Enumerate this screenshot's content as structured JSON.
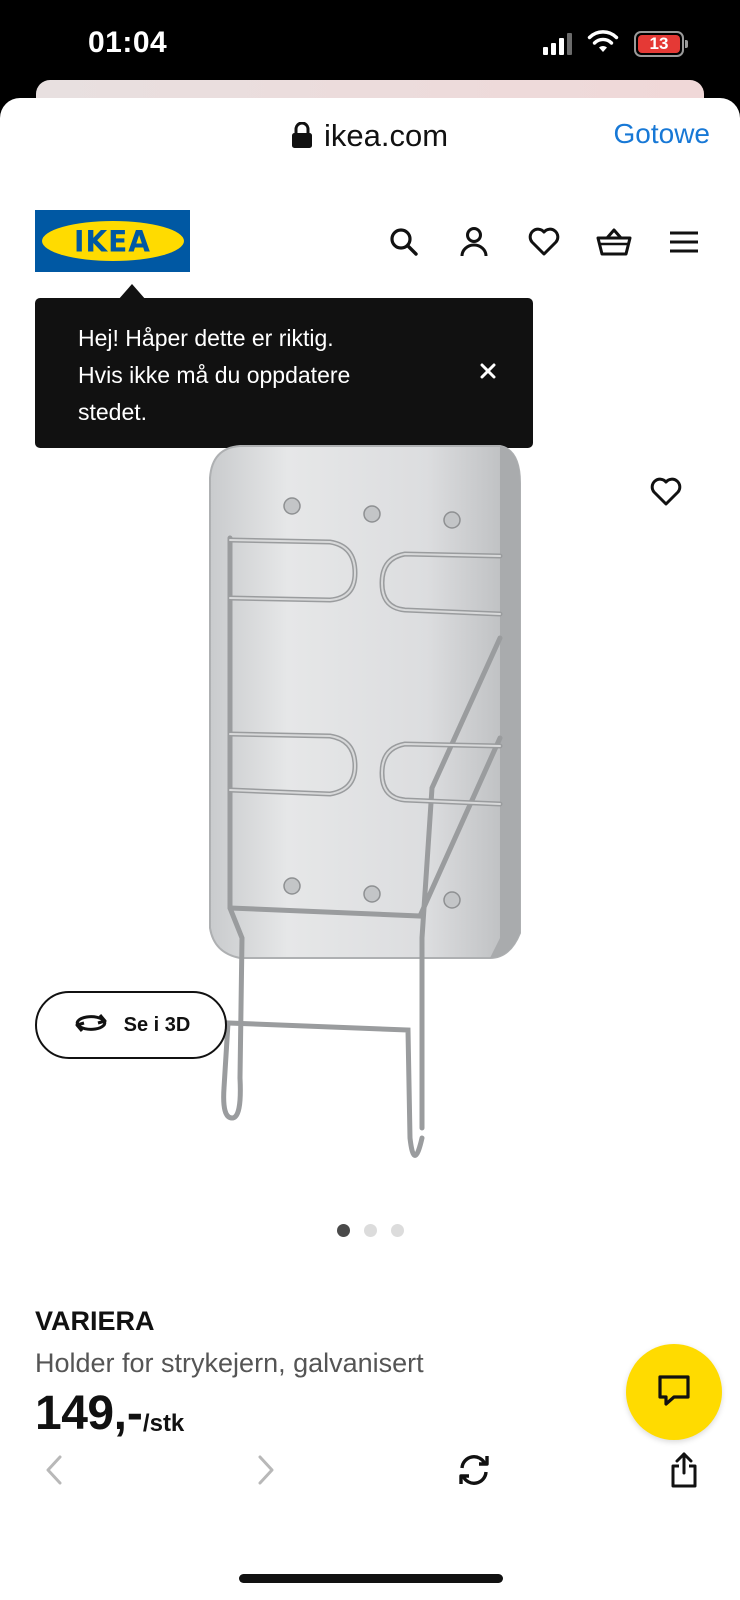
{
  "status_bar": {
    "time": "01:04",
    "battery": "13"
  },
  "browser": {
    "url": "ikea.com",
    "done_label": "Gotowe"
  },
  "header": {
    "logo_text": "IKEA",
    "icons": [
      "search-icon",
      "account-icon",
      "favourites-icon",
      "basket-icon",
      "menu-icon"
    ]
  },
  "tooltip": {
    "lines": [
      "Hej! Håper dette er riktig.",
      "Hvis ikke må du oppdatere",
      "stedet."
    ]
  },
  "gallery": {
    "button_3d_label": "Se i 3D",
    "dot_count": 3,
    "active_dot": 0
  },
  "product": {
    "name": "VARIERA",
    "description": "Holder for strykejern, galvanisert",
    "price": "149",
    "price_suffix": ",-",
    "unit": "/stk"
  },
  "colors": {
    "brand_blue": "#0058a3",
    "brand_yellow": "#ffdb00",
    "link_blue": "#1778d6",
    "battery_low": "#e53935"
  }
}
